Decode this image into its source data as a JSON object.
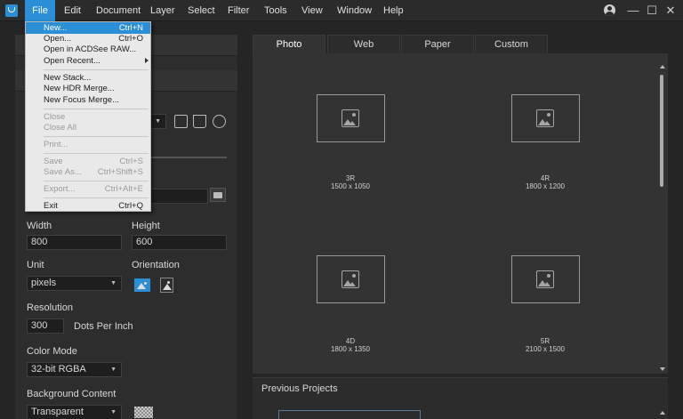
{
  "menubar": {
    "items": [
      "File",
      "Edit",
      "Document",
      "Layer",
      "Select",
      "Filter",
      "Tools",
      "View",
      "Window",
      "Help"
    ]
  },
  "file_menu": {
    "items": [
      {
        "label": "New...",
        "shortcut": "Ctrl+N",
        "state": "highlighted"
      },
      {
        "label": "Open...",
        "shortcut": "Ctrl+O",
        "state": "enabled"
      },
      {
        "label": "Open in ACDSee RAW...",
        "shortcut": "",
        "state": "enabled"
      },
      {
        "label": "Open Recent...",
        "shortcut": "",
        "state": "enabled",
        "submenu": true
      },
      {
        "label": "New Stack...",
        "shortcut": "",
        "state": "enabled"
      },
      {
        "label": "New HDR Merge...",
        "shortcut": "",
        "state": "enabled"
      },
      {
        "label": "New Focus Merge...",
        "shortcut": "",
        "state": "enabled"
      },
      {
        "label": "Close",
        "shortcut": "",
        "state": "disabled"
      },
      {
        "label": "Close All",
        "shortcut": "",
        "state": "disabled"
      },
      {
        "label": "Print...",
        "shortcut": "",
        "state": "disabled"
      },
      {
        "label": "Save",
        "shortcut": "Ctrl+S",
        "state": "disabled"
      },
      {
        "label": "Save As...",
        "shortcut": "Ctrl+Shift+S",
        "state": "disabled"
      },
      {
        "label": "Export...",
        "shortcut": "Ctrl+Alt+E",
        "state": "disabled"
      },
      {
        "label": "Exit",
        "shortcut": "Ctrl+Q",
        "state": "enabled"
      }
    ]
  },
  "settings": {
    "width_label": "Width",
    "width_value": "800",
    "height_label": "Height",
    "height_value": "600",
    "unit_label": "Unit",
    "unit_value": "pixels",
    "orientation_label": "Orientation",
    "resolution_label": "Resolution",
    "resolution_value": "300",
    "resolution_unit": "Dots Per Inch",
    "color_mode_label": "Color Mode",
    "color_mode_value": "32-bit RGBA",
    "background_label": "Background Content",
    "background_value": "Transparent"
  },
  "tabs": [
    "Photo",
    "Web",
    "Paper",
    "Custom"
  ],
  "presets": [
    {
      "name": "3R",
      "dims": "1500 x 1050"
    },
    {
      "name": "4R",
      "dims": "1800 x 1200"
    },
    {
      "name": "4D",
      "dims": "1800 x 1350"
    },
    {
      "name": "5R",
      "dims": "2100 x 1500"
    }
  ],
  "previous_projects": {
    "title": "Previous Projects"
  },
  "colors": {
    "accent": "#2a8fd6",
    "background": "#252525",
    "panel": "#2d2d2d"
  }
}
